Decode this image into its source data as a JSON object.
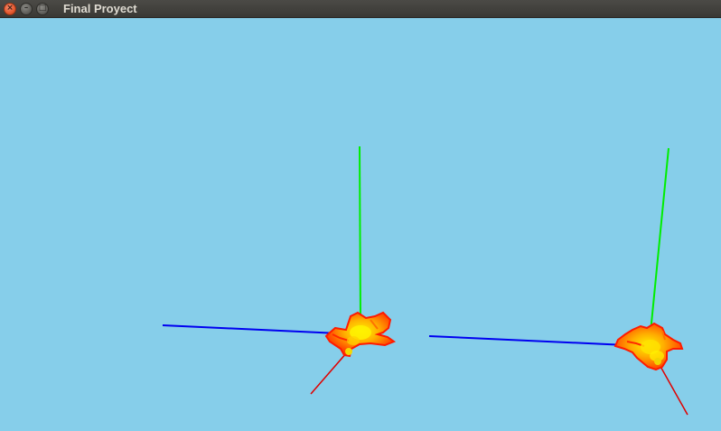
{
  "window": {
    "title": "Final Proyect",
    "controls": [
      {
        "name": "close",
        "glyph": "×",
        "icon": "close-icon"
      },
      {
        "name": "minimize",
        "glyph": "–",
        "icon": "minimize-icon"
      },
      {
        "name": "maximize",
        "glyph": "□",
        "icon": "maximize-icon"
      }
    ]
  },
  "colors": {
    "viewport_background": "#86ceea",
    "axis_x": "#ff0000",
    "axis_y": "#00ff00",
    "axis_z": "#0000ff",
    "model_outer": "#ff1500",
    "model_mid": "#ff8a00",
    "model_core": "#ffef00"
  },
  "scene": {
    "objects": [
      {
        "name": "left-model",
        "icon": "airplane-model-icon"
      },
      {
        "name": "right-model",
        "icon": "airplane-model-icon"
      }
    ]
  }
}
